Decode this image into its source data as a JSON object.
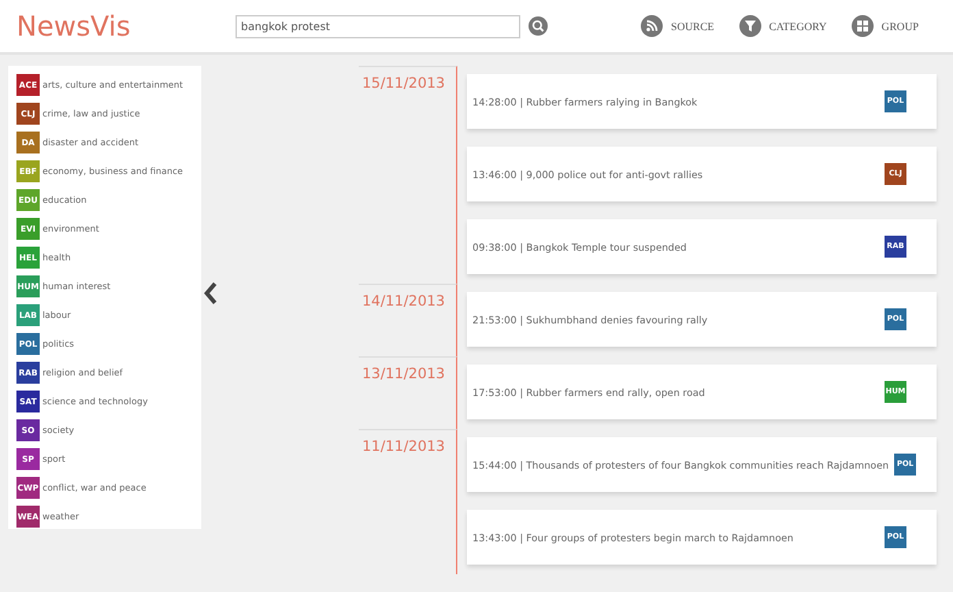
{
  "app": {
    "logo": "NewsVis"
  },
  "search": {
    "value": "bangkok protest"
  },
  "nav": [
    {
      "kind": "source",
      "label": "SOURCE"
    },
    {
      "kind": "category",
      "label": "CATEGORY"
    },
    {
      "kind": "group",
      "label": "GROUP"
    },
    {
      "kind": "more"
    }
  ],
  "legend": [
    {
      "code": "ACE",
      "label": "arts, culture and entertainment",
      "color": "#b5202a"
    },
    {
      "code": "CLJ",
      "label": "crime, law and justice",
      "color": "#a0451e"
    },
    {
      "code": "DA",
      "label": "disaster and accident",
      "color": "#a8701f"
    },
    {
      "code": "EBF",
      "label": "economy, business and finance",
      "color": "#9aa51f"
    },
    {
      "code": "EDU",
      "label": "education",
      "color": "#5ea62a"
    },
    {
      "code": "EVI",
      "label": "environment",
      "color": "#3a9e2a"
    },
    {
      "code": "HEL",
      "label": "health",
      "color": "#2aa23a"
    },
    {
      "code": "HUM",
      "label": "human interest",
      "color": "#2a9e5a"
    },
    {
      "code": "LAB",
      "label": "labour",
      "color": "#2aa07a"
    },
    {
      "code": "POL",
      "label": "politics",
      "color": "#2a6e9e"
    },
    {
      "code": "RAB",
      "label": "religion and belief",
      "color": "#2a3e9e"
    },
    {
      "code": "SAT",
      "label": "science and technology",
      "color": "#2a2a9e"
    },
    {
      "code": "SO",
      "label": "society",
      "color": "#6a2aa0"
    },
    {
      "code": "SP",
      "label": "sport",
      "color": "#9a2aa0"
    },
    {
      "code": "CWP",
      "label": "conflict, war and peace",
      "color": "#a02a80"
    },
    {
      "code": "WEA",
      "label": "weather",
      "color": "#a02a6a"
    }
  ],
  "timeline": [
    {
      "date": "15/11/2013",
      "items": [
        {
          "text": "14:28:00 | Rubber farmers ralying in Bangkok",
          "badge": "POL",
          "color": "#2a6e9e"
        },
        {
          "text": "13:46:00 | 9,000 police out for anti-govt rallies",
          "badge": "CLJ",
          "color": "#a0451e"
        },
        {
          "text": "09:38:00 | Bangkok Temple tour suspended",
          "badge": "RAB",
          "color": "#2a3e9e"
        }
      ]
    },
    {
      "date": "14/11/2013",
      "items": [
        {
          "text": "21:53:00 | Sukhumbhand denies favouring rally",
          "badge": "POL",
          "color": "#2a6e9e"
        }
      ]
    },
    {
      "date": "13/11/2013",
      "items": [
        {
          "text": "17:53:00 | Rubber farmers end rally, open road",
          "badge": "HUM",
          "color": "#2a9e3a"
        }
      ]
    },
    {
      "date": "11/11/2013",
      "items": [
        {
          "text": "15:44:00 | Thousands of protesters of four Bangkok communities reach Rajdamnoen",
          "badge": "POL",
          "color": "#2a6e9e"
        },
        {
          "text": "13:43:00 | Four groups of protesters begin march to Rajdamnoen",
          "badge": "POL",
          "color": "#2a6e9e"
        }
      ]
    }
  ]
}
